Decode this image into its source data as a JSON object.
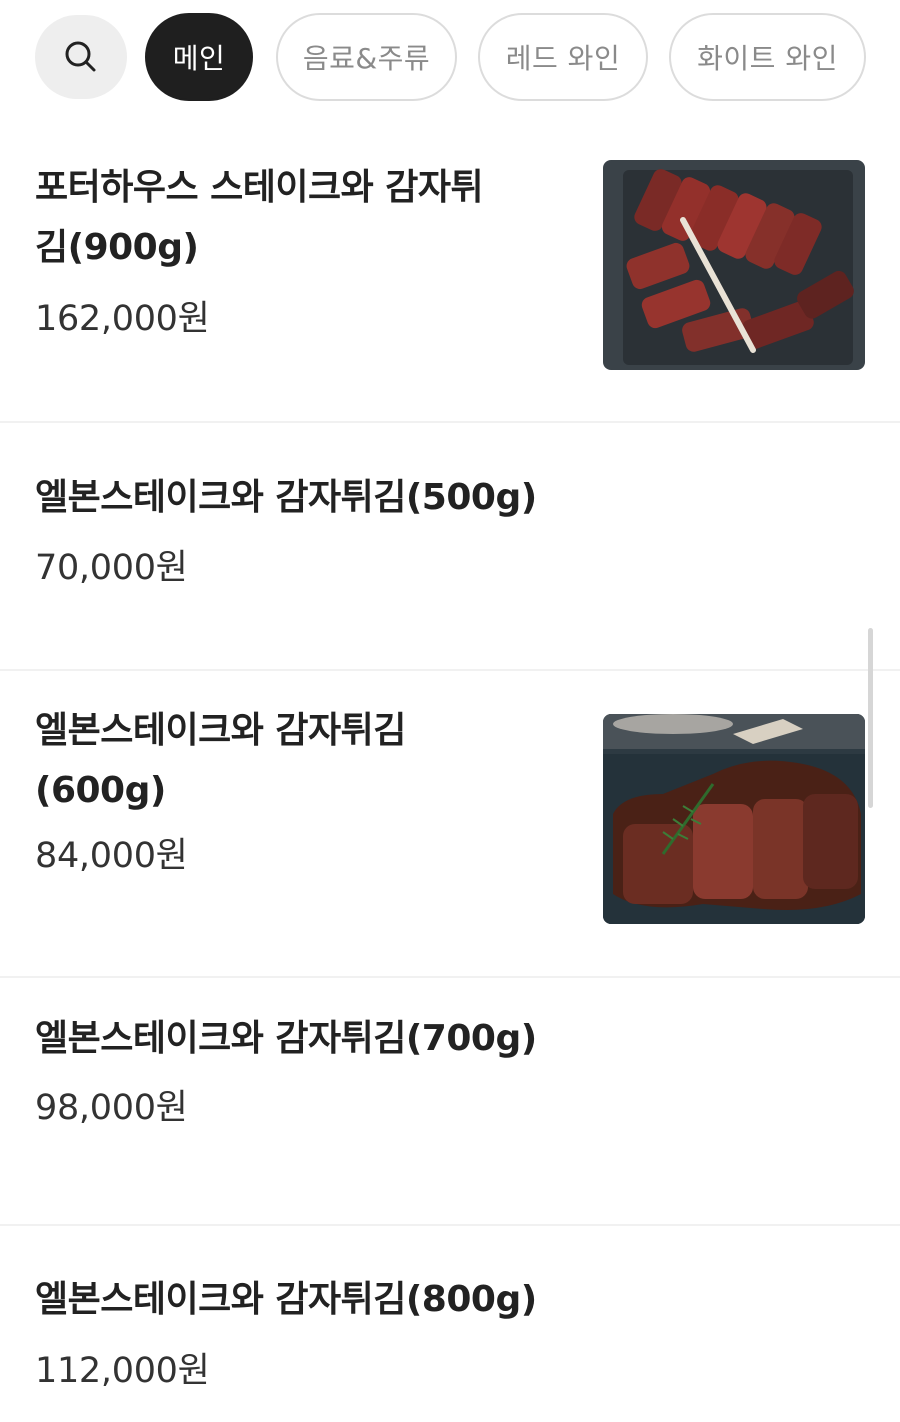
{
  "category_bar": {
    "search_icon": "search-icon",
    "tabs": [
      {
        "label": "메인",
        "active": true
      },
      {
        "label": "음료&주류",
        "active": false
      },
      {
        "label": "레드 와인",
        "active": false
      },
      {
        "label": "화이트 와인",
        "active": false
      }
    ]
  },
  "menu": {
    "items": [
      {
        "name": "포터하우스 스테이크와 감자튀김(900g)",
        "price": "162,000원",
        "has_photo": true,
        "photo": "porterhouse-steak-photo"
      },
      {
        "name": "엘본스테이크와 감자튀김(500g)",
        "price": "70,000원",
        "has_photo": false
      },
      {
        "name": "엘본스테이크와 감자튀김(600g)",
        "price": "84,000원",
        "has_photo": true,
        "photo": "l-bone-steak-photo"
      },
      {
        "name": "엘본스테이크와 감자튀김(700g)",
        "price": "98,000원",
        "has_photo": false
      },
      {
        "name": "엘본스테이크와 감자튀김(800g)",
        "price": "112,000원",
        "has_photo": false
      }
    ]
  },
  "colors": {
    "active_chip_bg": "#1f1f1f",
    "chip_border": "#dcdcdc",
    "search_bg": "#eeeeee",
    "divider": "#f1f1f1"
  }
}
